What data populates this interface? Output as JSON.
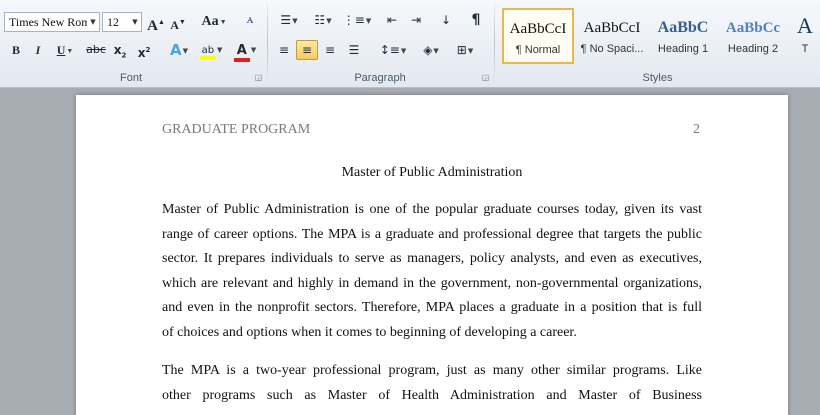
{
  "font": {
    "name": "Times New Rom",
    "size": "12",
    "grow_glyph": "A",
    "shrink_glyph": "A",
    "case_glyph": "Aa",
    "bold": "B",
    "italic": "I",
    "underline": "U",
    "strike": "abc",
    "subscript": "x",
    "superscript": "x",
    "text_effects_glyph": "A",
    "highlight_glyph": "ab",
    "font_color_glyph": "A",
    "group_label": "Font"
  },
  "paragraph": {
    "group_label": "Paragraph",
    "pilcrow": "¶"
  },
  "styles": {
    "group_label": "Styles",
    "items": [
      {
        "sample": "AaBbCcI",
        "name": "¶ Normal"
      },
      {
        "sample": "AaBbCcI",
        "name": "¶ No Spaci..."
      },
      {
        "sample": "AaBbC",
        "name": "Heading 1"
      },
      {
        "sample": "AaBbCc",
        "name": "Heading 2"
      },
      {
        "sample": "A",
        "name": "T"
      }
    ]
  },
  "document": {
    "header_left": "GRADUATE PROGRAM",
    "header_right": "2",
    "title": "Master of Public Administration",
    "para1": [
      "Master of Public Administration is one of the popular graduate courses today, given its vast",
      "range of career options. The MPA is a graduate and professional degree that targets the public",
      "sector. It prepares individuals to serve as managers, policy analysts, and even as executives,",
      "which are relevant and highly in demand in the government, non-governmental organizations,",
      "and even in the nonprofit sectors. Therefore, MPA places a graduate in a position that is full",
      "of choices and options when it comes to beginning of developing a career."
    ],
    "para2": [
      "The MPA is a two-year professional program, just as many other similar programs. Like",
      "other programs such as Master of Health Administration and Master of Business"
    ]
  },
  "colors": {
    "accent_active": "#f7cc5c",
    "highlight_yellow": "#ffff00",
    "font_color_red": "#e02020"
  }
}
